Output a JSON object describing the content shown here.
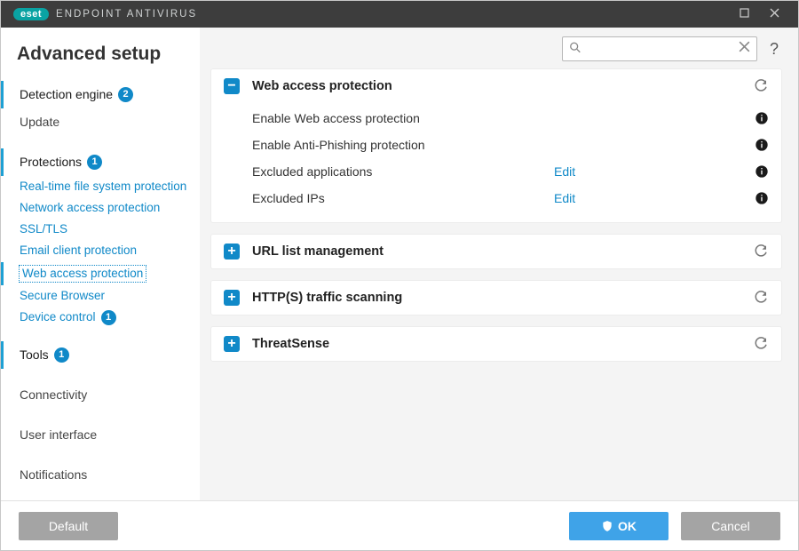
{
  "titlebar": {
    "brand": "eset",
    "product": "ENDPOINT ANTIVIRUS"
  },
  "page_title": "Advanced setup",
  "sidebar": {
    "sections": [
      {
        "kind": "major",
        "label": "Detection engine",
        "badge": "2",
        "active": true
      },
      {
        "kind": "major",
        "label": "Update"
      },
      {
        "kind": "gap"
      },
      {
        "kind": "major",
        "label": "Protections",
        "badge": "1",
        "active": true
      },
      {
        "kind": "sub",
        "label": "Real-time file system protection"
      },
      {
        "kind": "sub",
        "label": "Network access protection"
      },
      {
        "kind": "sub",
        "label": "SSL/TLS"
      },
      {
        "kind": "sub",
        "label": "Email client protection"
      },
      {
        "kind": "sub",
        "label": "Web access protection",
        "active": true,
        "selected": true
      },
      {
        "kind": "sub",
        "label": "Secure Browser"
      },
      {
        "kind": "sub",
        "label": "Device control",
        "badge": "1"
      },
      {
        "kind": "gap"
      },
      {
        "kind": "major",
        "label": "Tools",
        "badge": "1",
        "active": true
      },
      {
        "kind": "gap"
      },
      {
        "kind": "major",
        "label": "Connectivity"
      },
      {
        "kind": "gap"
      },
      {
        "kind": "major",
        "label": "User interface"
      },
      {
        "kind": "gap"
      },
      {
        "kind": "major",
        "label": "Notifications"
      }
    ]
  },
  "search": {
    "placeholder": ""
  },
  "panels": [
    {
      "title": "Web access protection",
      "expanded": true,
      "rows": [
        {
          "label": "Enable Web access protection",
          "type": "toggle",
          "value": true
        },
        {
          "label": "Enable Anti-Phishing protection",
          "type": "toggle",
          "value": true
        },
        {
          "label": "Excluded applications",
          "type": "link",
          "action": "Edit"
        },
        {
          "label": "Excluded IPs",
          "type": "link",
          "action": "Edit"
        }
      ]
    },
    {
      "title": "URL list management",
      "expanded": false
    },
    {
      "title": "HTTP(S) traffic scanning",
      "expanded": false
    },
    {
      "title": "ThreatSense",
      "expanded": false
    }
  ],
  "footer": {
    "default_label": "Default",
    "ok_label": "OK",
    "cancel_label": "Cancel"
  }
}
